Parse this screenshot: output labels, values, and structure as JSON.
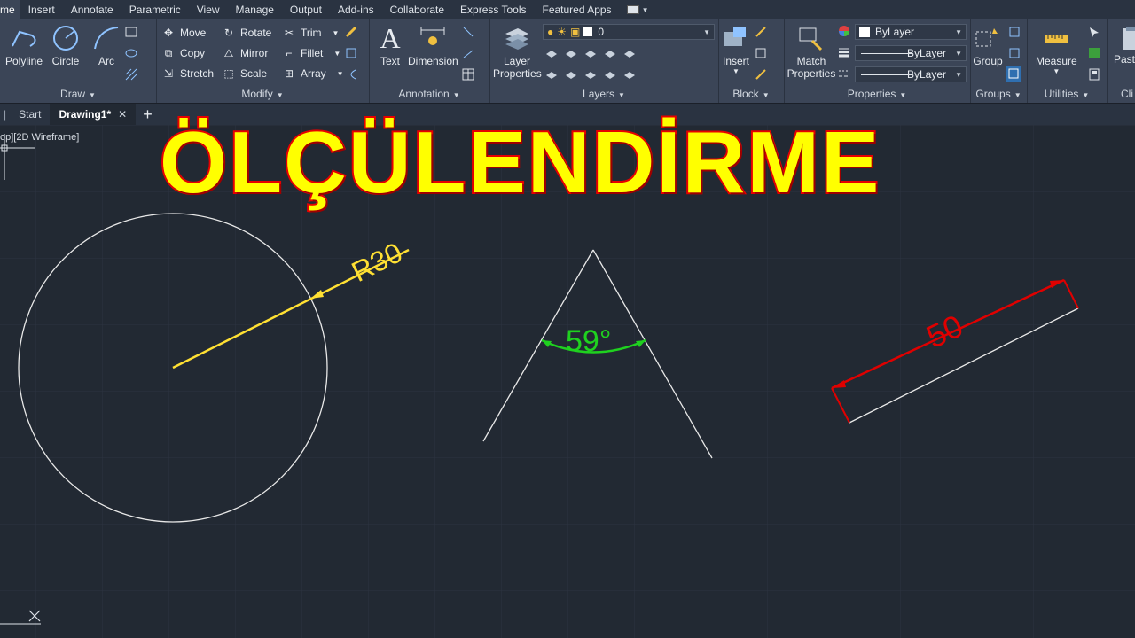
{
  "menu": {
    "tabs": [
      "me",
      "Insert",
      "Annotate",
      "Parametric",
      "View",
      "Manage",
      "Output",
      "Add-ins",
      "Collaborate",
      "Express Tools",
      "Featured Apps"
    ]
  },
  "ribbon": {
    "draw": {
      "title": "Draw",
      "polyline": "Polyline",
      "circle": "Circle",
      "arc": "Arc"
    },
    "modify": {
      "title": "Modify",
      "move": "Move",
      "rotate": "Rotate",
      "trim": "Trim",
      "copy": "Copy",
      "mirror": "Mirror",
      "fillet": "Fillet",
      "stretch": "Stretch",
      "scale": "Scale",
      "array": "Array"
    },
    "annotation": {
      "title": "Annotation",
      "text": "Text",
      "dimension": "Dimension"
    },
    "layers": {
      "title": "Layers",
      "layer_properties_1": "Layer",
      "layer_properties_2": "Properties",
      "current_layer": "0"
    },
    "block": {
      "title": "Block",
      "insert": "Insert"
    },
    "properties": {
      "title": "Properties",
      "match_1": "Match",
      "match_2": "Properties",
      "color": "ByLayer",
      "linetype": "ByLayer",
      "lineweight": "ByLayer"
    },
    "groups": {
      "title": "Groups",
      "group": "Group"
    },
    "utilities": {
      "title": "Utilities",
      "measure": "Measure"
    },
    "clipboard": {
      "title": "Cli",
      "paste": "Past"
    }
  },
  "file_tabs": {
    "start": "Start",
    "drawing": "Drawing1*"
  },
  "viewport": {
    "label": "op][2D Wireframe]"
  },
  "overlay_title": "ÖLÇÜLENDİRME",
  "drawing": {
    "radius_dim": "R30",
    "angle_dim": "59°",
    "linear_dim": "50",
    "colors": {
      "radius": "#ffe033",
      "angle": "#1fd11f",
      "linear": "#e00000",
      "geometry": "#e8e8e8"
    }
  }
}
